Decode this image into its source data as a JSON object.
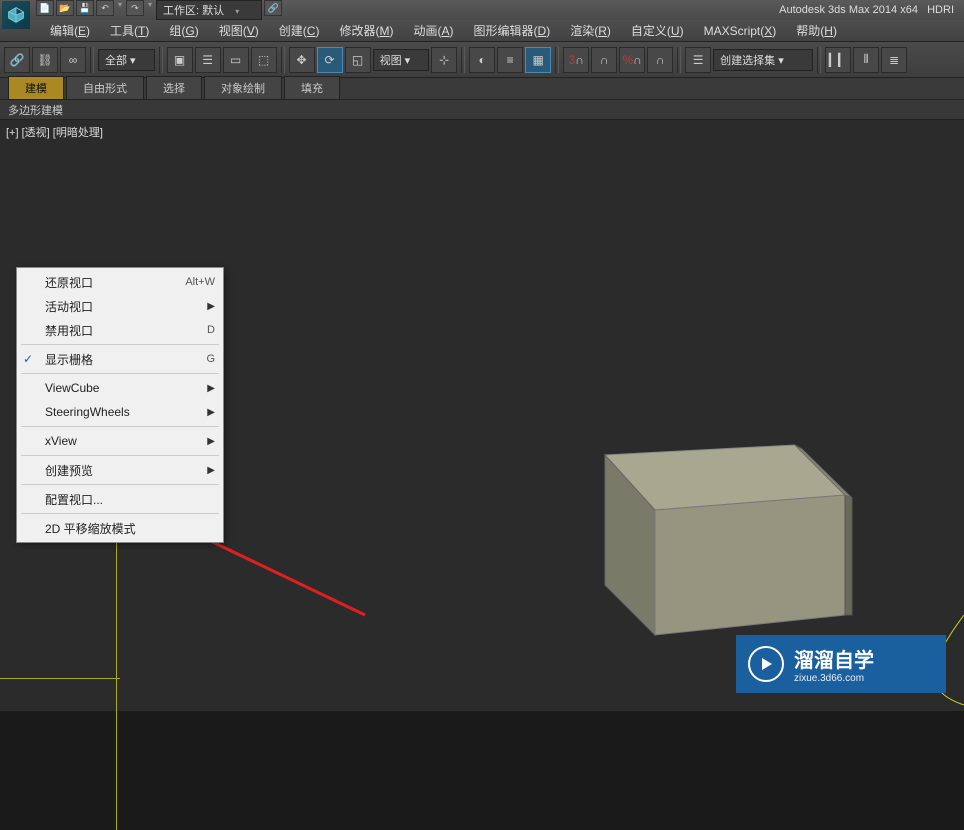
{
  "app": {
    "title": "Autodesk 3ds Max  2014 x64",
    "title_suffix": "HDRI"
  },
  "workspace": {
    "label": "工作区: 默认"
  },
  "menubar": {
    "items": [
      {
        "label": "编辑",
        "accel": "E"
      },
      {
        "label": "工具",
        "accel": "T"
      },
      {
        "label": "组",
        "accel": "G"
      },
      {
        "label": "视图",
        "accel": "V"
      },
      {
        "label": "创建",
        "accel": "C"
      },
      {
        "label": "修改器",
        "accel": "M"
      },
      {
        "label": "动画",
        "accel": "A"
      },
      {
        "label": "图形编辑器",
        "accel": "D"
      },
      {
        "label": "渲染",
        "accel": "R"
      },
      {
        "label": "自定义",
        "accel": "U"
      },
      {
        "label": "MAXScript",
        "accel": "X"
      },
      {
        "label": "帮助",
        "accel": "H"
      }
    ]
  },
  "toolbar": {
    "filter_dropdown": "全部",
    "view_dropdown": "视图",
    "selection_set": "创建选择集"
  },
  "tabs": {
    "items": [
      {
        "label": "建模",
        "active": true
      },
      {
        "label": "自由形式",
        "active": false
      },
      {
        "label": "选择",
        "active": false
      },
      {
        "label": "对象绘制",
        "active": false
      },
      {
        "label": "填充",
        "active": false
      }
    ]
  },
  "subrow": {
    "label": "多边形建模"
  },
  "viewport": {
    "label_parts": [
      "[+]",
      "[透视]",
      "[明暗处理]"
    ]
  },
  "context_menu": {
    "items": [
      {
        "label": "还原视口",
        "shortcut": "Alt+W",
        "type": "item"
      },
      {
        "label": "活动视口",
        "type": "submenu"
      },
      {
        "label": "禁用视口",
        "shortcut": "D",
        "type": "item"
      },
      {
        "type": "sep"
      },
      {
        "label": "显示栅格",
        "shortcut": "G",
        "type": "item",
        "checked": true
      },
      {
        "type": "sep"
      },
      {
        "label": "ViewCube",
        "type": "submenu"
      },
      {
        "label": "SteeringWheels",
        "type": "submenu"
      },
      {
        "type": "sep"
      },
      {
        "label": "xView",
        "type": "submenu"
      },
      {
        "type": "sep"
      },
      {
        "label": "创建预览",
        "type": "submenu"
      },
      {
        "type": "sep"
      },
      {
        "label": "配置视口...",
        "type": "item"
      },
      {
        "type": "sep"
      },
      {
        "label": "2D 平移缩放模式",
        "type": "item"
      }
    ]
  },
  "watermark": {
    "main": "溜溜自学",
    "sub": "zixue.3d66.com"
  }
}
